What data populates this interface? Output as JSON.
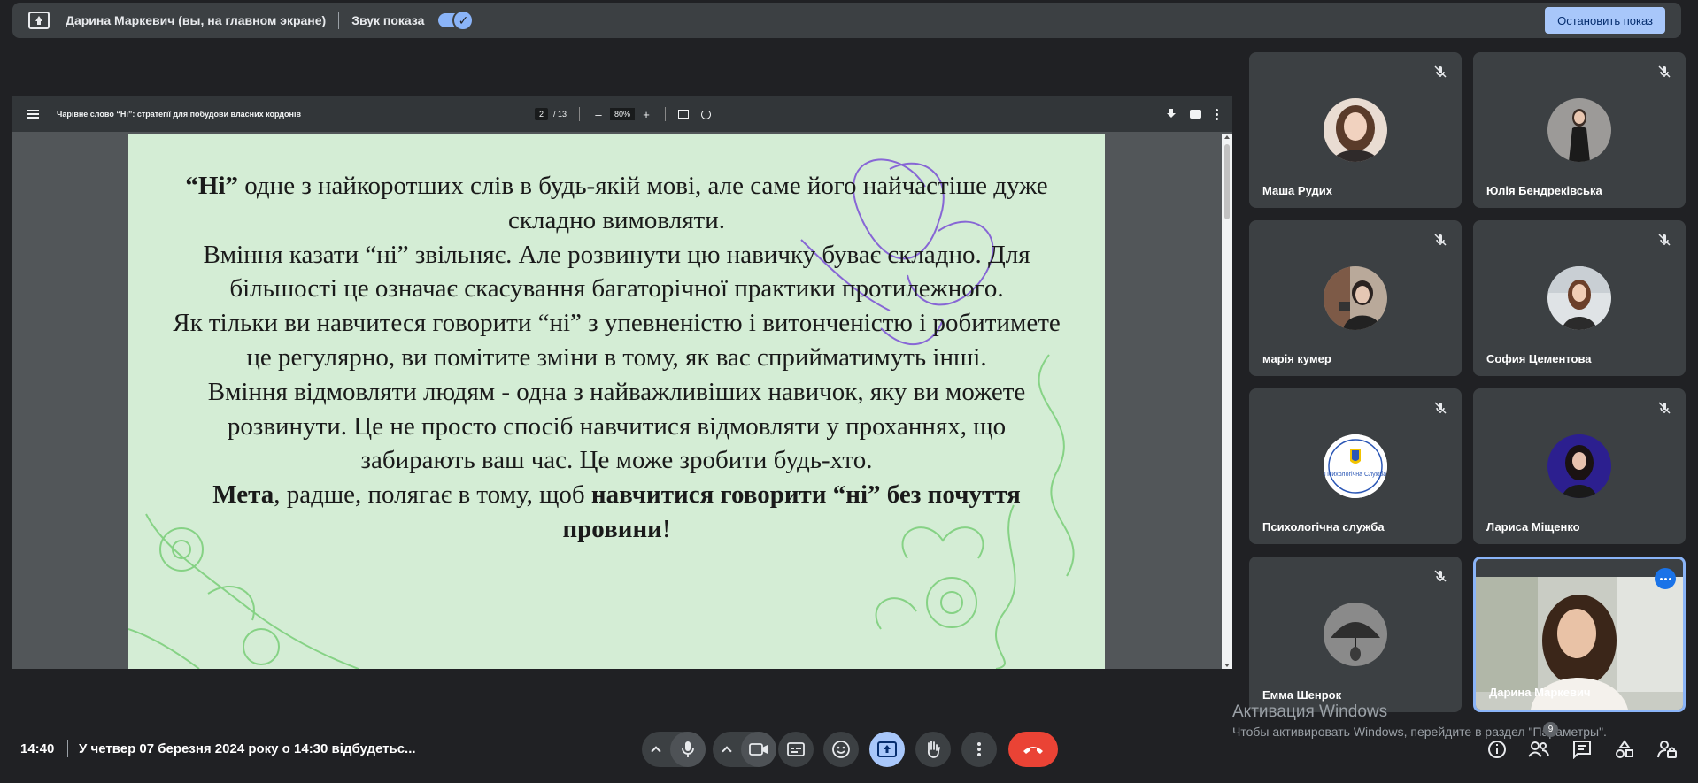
{
  "topbar": {
    "title": "Дарина Маркевич (вы, на главном экране)",
    "sound_label": "Звук показа",
    "stop_button": "Остановить показ"
  },
  "pdf": {
    "title": "Чарівне слово “Ні”: стратегії для побудови власних кордонів",
    "page_current": "2",
    "page_total": "/ 13",
    "zoom": "80%",
    "zoom_out": "–",
    "zoom_in": "+"
  },
  "slide": {
    "p1_bold": "“Ні”",
    "p1_rest": " одне з найкоротших слів в будь-якій мові, але саме його найчастіше дуже складно вимовляти.",
    "p2": "Вміння казати “ні” звільняє. Але розвинути цю навичку буває складно. Для більшості це означає скасування багаторічної практики протилежного.",
    "p3": "Як тільки ви навчитеся говорити “ні” з упевненістю і витонченістю і робитимете це регулярно, ви помітите зміни в тому, як вас сприйматимуть інші.",
    "p4": "Вміння відмовляти людям - одна з найважливіших навичок, яку ви можете розвинути. Це не просто спосіб навчитися відмовляти у проханнях, що забирають ваш час. Це може зробити будь-хто.",
    "p5_bold1": "Мета",
    "p5_mid": ", радше, полягає в тому, щоб ",
    "p5_bold2": "навчитися говорити “ні” без почуття провини",
    "p5_end": "!"
  },
  "participants": [
    {
      "name": "Маша Рудих"
    },
    {
      "name": "Юлія Бендреківська"
    },
    {
      "name": "марія кумер"
    },
    {
      "name": "София Цементова"
    },
    {
      "name": "Психологічна служба",
      "logo_text": "Психологічна Служба"
    },
    {
      "name": "Лариса Міщенко"
    },
    {
      "name": "Емма Шенрок"
    },
    {
      "name": "Дарина Маркевич"
    }
  ],
  "bottom": {
    "time": "14:40",
    "meeting": "У четвер 07 березня 2024 року о 14:30 відбудетьс...",
    "participants_count": "9"
  },
  "watermark": {
    "line1": "Активация Windows",
    "line2": "Чтобы активировать Windows, перейдите в раздел \"Параметры\"."
  },
  "colors": {
    "background": "#202124",
    "panel": "#3c4043",
    "accent": "#8ab4f8",
    "hangup": "#ea4335",
    "slide_bg": "#d4edd5"
  }
}
